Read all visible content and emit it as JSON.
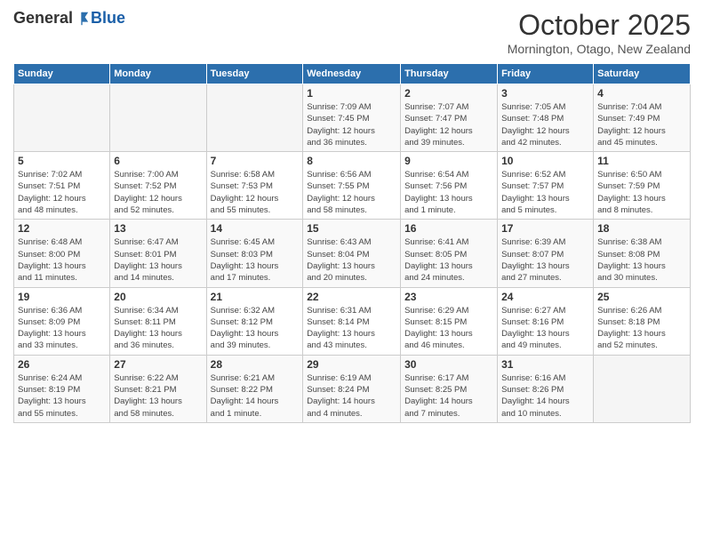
{
  "header": {
    "logo": {
      "general": "General",
      "blue": "Blue"
    },
    "title": "October 2025",
    "location": "Mornington, Otago, New Zealand"
  },
  "days_of_week": [
    "Sunday",
    "Monday",
    "Tuesday",
    "Wednesday",
    "Thursday",
    "Friday",
    "Saturday"
  ],
  "weeks": [
    [
      {
        "day": "",
        "info": ""
      },
      {
        "day": "",
        "info": ""
      },
      {
        "day": "",
        "info": ""
      },
      {
        "day": "1",
        "info": "Sunrise: 7:09 AM\nSunset: 7:45 PM\nDaylight: 12 hours\nand 36 minutes."
      },
      {
        "day": "2",
        "info": "Sunrise: 7:07 AM\nSunset: 7:47 PM\nDaylight: 12 hours\nand 39 minutes."
      },
      {
        "day": "3",
        "info": "Sunrise: 7:05 AM\nSunset: 7:48 PM\nDaylight: 12 hours\nand 42 minutes."
      },
      {
        "day": "4",
        "info": "Sunrise: 7:04 AM\nSunset: 7:49 PM\nDaylight: 12 hours\nand 45 minutes."
      }
    ],
    [
      {
        "day": "5",
        "info": "Sunrise: 7:02 AM\nSunset: 7:51 PM\nDaylight: 12 hours\nand 48 minutes."
      },
      {
        "day": "6",
        "info": "Sunrise: 7:00 AM\nSunset: 7:52 PM\nDaylight: 12 hours\nand 52 minutes."
      },
      {
        "day": "7",
        "info": "Sunrise: 6:58 AM\nSunset: 7:53 PM\nDaylight: 12 hours\nand 55 minutes."
      },
      {
        "day": "8",
        "info": "Sunrise: 6:56 AM\nSunset: 7:55 PM\nDaylight: 12 hours\nand 58 minutes."
      },
      {
        "day": "9",
        "info": "Sunrise: 6:54 AM\nSunset: 7:56 PM\nDaylight: 13 hours\nand 1 minute."
      },
      {
        "day": "10",
        "info": "Sunrise: 6:52 AM\nSunset: 7:57 PM\nDaylight: 13 hours\nand 5 minutes."
      },
      {
        "day": "11",
        "info": "Sunrise: 6:50 AM\nSunset: 7:59 PM\nDaylight: 13 hours\nand 8 minutes."
      }
    ],
    [
      {
        "day": "12",
        "info": "Sunrise: 6:48 AM\nSunset: 8:00 PM\nDaylight: 13 hours\nand 11 minutes."
      },
      {
        "day": "13",
        "info": "Sunrise: 6:47 AM\nSunset: 8:01 PM\nDaylight: 13 hours\nand 14 minutes."
      },
      {
        "day": "14",
        "info": "Sunrise: 6:45 AM\nSunset: 8:03 PM\nDaylight: 13 hours\nand 17 minutes."
      },
      {
        "day": "15",
        "info": "Sunrise: 6:43 AM\nSunset: 8:04 PM\nDaylight: 13 hours\nand 20 minutes."
      },
      {
        "day": "16",
        "info": "Sunrise: 6:41 AM\nSunset: 8:05 PM\nDaylight: 13 hours\nand 24 minutes."
      },
      {
        "day": "17",
        "info": "Sunrise: 6:39 AM\nSunset: 8:07 PM\nDaylight: 13 hours\nand 27 minutes."
      },
      {
        "day": "18",
        "info": "Sunrise: 6:38 AM\nSunset: 8:08 PM\nDaylight: 13 hours\nand 30 minutes."
      }
    ],
    [
      {
        "day": "19",
        "info": "Sunrise: 6:36 AM\nSunset: 8:09 PM\nDaylight: 13 hours\nand 33 minutes."
      },
      {
        "day": "20",
        "info": "Sunrise: 6:34 AM\nSunset: 8:11 PM\nDaylight: 13 hours\nand 36 minutes."
      },
      {
        "day": "21",
        "info": "Sunrise: 6:32 AM\nSunset: 8:12 PM\nDaylight: 13 hours\nand 39 minutes."
      },
      {
        "day": "22",
        "info": "Sunrise: 6:31 AM\nSunset: 8:14 PM\nDaylight: 13 hours\nand 43 minutes."
      },
      {
        "day": "23",
        "info": "Sunrise: 6:29 AM\nSunset: 8:15 PM\nDaylight: 13 hours\nand 46 minutes."
      },
      {
        "day": "24",
        "info": "Sunrise: 6:27 AM\nSunset: 8:16 PM\nDaylight: 13 hours\nand 49 minutes."
      },
      {
        "day": "25",
        "info": "Sunrise: 6:26 AM\nSunset: 8:18 PM\nDaylight: 13 hours\nand 52 minutes."
      }
    ],
    [
      {
        "day": "26",
        "info": "Sunrise: 6:24 AM\nSunset: 8:19 PM\nDaylight: 13 hours\nand 55 minutes."
      },
      {
        "day": "27",
        "info": "Sunrise: 6:22 AM\nSunset: 8:21 PM\nDaylight: 13 hours\nand 58 minutes."
      },
      {
        "day": "28",
        "info": "Sunrise: 6:21 AM\nSunset: 8:22 PM\nDaylight: 14 hours\nand 1 minute."
      },
      {
        "day": "29",
        "info": "Sunrise: 6:19 AM\nSunset: 8:24 PM\nDaylight: 14 hours\nand 4 minutes."
      },
      {
        "day": "30",
        "info": "Sunrise: 6:17 AM\nSunset: 8:25 PM\nDaylight: 14 hours\nand 7 minutes."
      },
      {
        "day": "31",
        "info": "Sunrise: 6:16 AM\nSunset: 8:26 PM\nDaylight: 14 hours\nand 10 minutes."
      },
      {
        "day": "",
        "info": ""
      }
    ]
  ]
}
